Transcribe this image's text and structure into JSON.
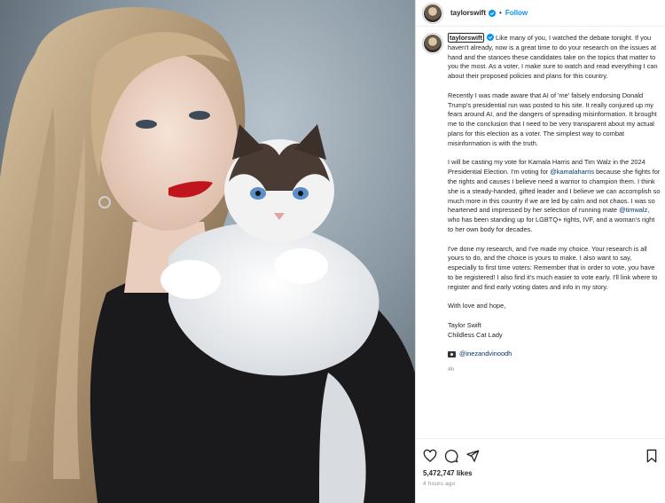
{
  "header": {
    "username": "taylorswift",
    "separator": "•",
    "follow_label": "Follow"
  },
  "icons": {
    "verified": "verified-badge-icon",
    "like": "heart-icon",
    "comment": "comment-icon",
    "share": "share-icon",
    "save": "bookmark-icon",
    "credit": "camera-icon"
  },
  "colors": {
    "accent": "#0095f6",
    "mention": "#00376b",
    "muted": "#8e8e8e",
    "text": "#262626"
  },
  "caption": {
    "username": "taylorswift",
    "p1": "Like many of you, I watched the debate tonight. If you haven't already, now is a great time to do your research on the issues at hand and the stances these candidates take on the topics that matter to you the most. As a voter, I make sure to watch and read everything I can about their proposed policies and plans for this country.",
    "p2": "Recently I was made aware that AI of 'me' falsely endorsing Donald Trump's presidential run was posted to his site. It really conjured up my fears around AI, and the dangers of spreading misinformation. It brought me to the conclusion that I need to be very transparent about my actual plans for this election as a voter. The simplest way to combat misinformation is with the truth.",
    "p3_a": "I will be casting my vote for Kamala Harris and Tim Walz in the 2024 Presidential Election. I'm voting for ",
    "p3_mention1": "@kamalaharris",
    "p3_b": " because she fights for the rights and causes I believe need a warrior to champion them. I think she is a steady-handed, gifted leader and I believe we can accomplish so much more in this country if we are led by calm and not chaos. I was so heartened and impressed by her selection of running mate ",
    "p3_mention2": "@timwalz",
    "p3_c": ", who has been standing up for LGBTQ+ rights, IVF, and a woman's right to her own body for decades.",
    "p4": "I've done my research, and I've made my choice. Your research is all yours to do, and the choice is yours to make. I also want to say, especially to first time voters: Remember that in order to vote, you have to be registered! I also find it's much easier to vote early. I'll link where to register and find early voting dates and info in my story.",
    "p5": "With love and hope,",
    "sign1": "Taylor Swift",
    "sign2": "Childless Cat Lady",
    "credit": "@inezandvinoodh",
    "relative_time": "4h"
  },
  "footer": {
    "likes": "5,472,747 likes",
    "posted": "4 hours ago"
  }
}
